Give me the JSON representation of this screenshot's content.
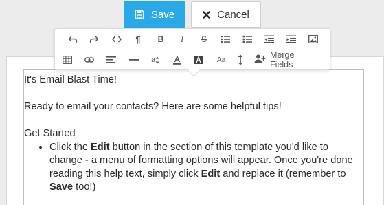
{
  "buttons": {
    "save_label": "Save",
    "cancel_label": "Cancel"
  },
  "colors": {
    "save_bg": "#29a9e8",
    "toolbar_icon": "#555555",
    "text": "#2a2a2a"
  },
  "toolbar": {
    "row1_icons": [
      "undo-icon",
      "redo-icon",
      "code-icon",
      "paragraph-icon",
      "bold-icon",
      "italic-icon",
      "strikethrough-icon",
      "unordered-list-icon",
      "ordered-list-icon",
      "outdent-icon",
      "indent-icon",
      "image-icon"
    ],
    "row2_icons": [
      "table-icon",
      "link-icon",
      "align-icon",
      "horizontal-rule-icon",
      "font-size-icon",
      "font-color-icon",
      "background-color-icon",
      "format-case-icon",
      "line-height-icon",
      "merge-fields-icon"
    ],
    "merge_fields_label": "Merge Fields"
  },
  "content": {
    "title": "It's Email Blast Time!",
    "intro": "Ready to email your contacts? Here are some helpful tips!",
    "section_heading": "Get Started",
    "bullet1": {
      "part1": "Click the ",
      "bold1": "Edit",
      "part2": " button in the section of this template you'd like to change - a menu of formatting options will appear. Once you're done reading this help text, simply click ",
      "bold2": "Edit",
      "part3": " and replace it (remember to ",
      "bold3": "Save",
      "part4": " too!)"
    }
  }
}
